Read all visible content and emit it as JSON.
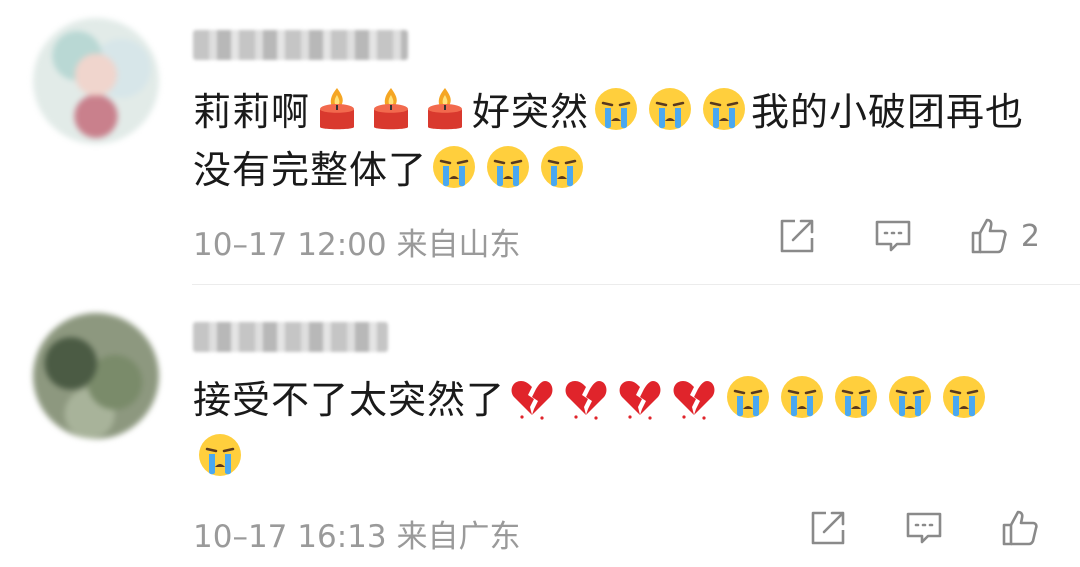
{
  "comments": [
    {
      "text_parts": [
        "莉莉啊",
        "好突然",
        "我的小破团再也没有完整体了"
      ],
      "emojis": [
        "candle",
        "candle",
        "candle",
        "crying",
        "crying",
        "crying",
        "crying",
        "crying",
        "crying"
      ],
      "time": "10–17 12:00",
      "location": "来自山东",
      "likes": "2"
    },
    {
      "text_parts": [
        "接受不了太突然了"
      ],
      "emojis": [
        "broken-heart",
        "broken-heart",
        "broken-heart",
        "broken-heart",
        "crying",
        "crying",
        "crying",
        "crying",
        "crying",
        "crying"
      ],
      "time": "10–17 16:13",
      "location": "来自广东",
      "likes": ""
    }
  ]
}
